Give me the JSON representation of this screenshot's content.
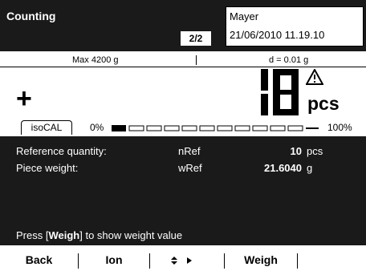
{
  "header": {
    "title": "Counting",
    "page_indicator": "2/2",
    "user": "Mayer",
    "datetime": "21/06/2010 11.19.10"
  },
  "capacity": {
    "max": "Max 4200 g",
    "readability": "d = 0.01 g"
  },
  "display": {
    "sign": "+",
    "value": "10",
    "unit": "pcs",
    "status_icon": "warning-triangle-icon"
  },
  "bargraph": {
    "iso_cal_label": "isoCAL",
    "min_label": "0%",
    "max_label": "100%",
    "fill_fraction": 0.0
  },
  "info": {
    "rows": [
      {
        "label": "Reference quantity:",
        "symbol": "nRef",
        "value": "10",
        "unit": "pcs"
      },
      {
        "label": "Piece weight:",
        "symbol": "wRef",
        "value": "21.6040",
        "unit": "g"
      }
    ],
    "message_prefix": "Press [",
    "message_key": "Weigh",
    "message_suffix": "] to show weight value"
  },
  "softkeys": {
    "back": "Back",
    "ion": "Ion",
    "updown_icon": "up-down-arrow-icon",
    "right_icon": "right-arrow-icon",
    "weigh": "Weigh"
  }
}
